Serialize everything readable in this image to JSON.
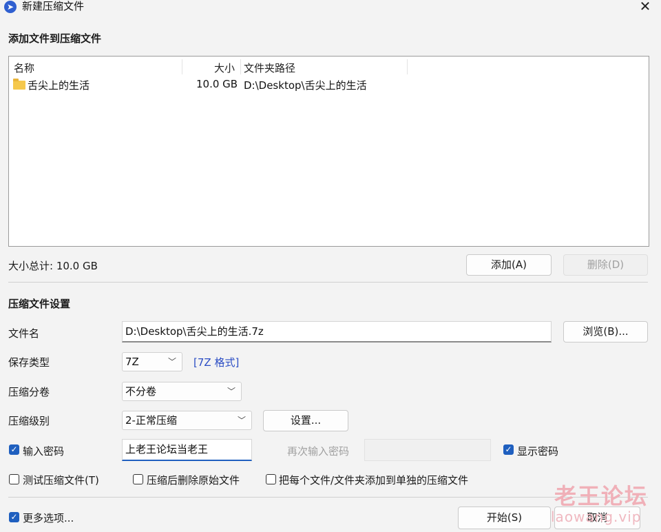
{
  "window": {
    "title": "新建压缩文件"
  },
  "add_section": {
    "title": "添加文件到压缩文件",
    "columns": {
      "name": "名称",
      "size": "大小",
      "path": "文件夹路径"
    },
    "rows": [
      {
        "name": "舌尖上的生活",
        "size": "10.0 GB",
        "path": "D:\\Desktop\\舌尖上的生活"
      }
    ],
    "total": "大小总计: 10.0 GB",
    "add_button": "添加(A)",
    "delete_button": "删除(D)"
  },
  "settings": {
    "title": "压缩文件设置",
    "filename_label": "文件名",
    "filename_value": "D:\\Desktop\\舌尖上的生活.7z",
    "browse_button": "浏览(B)...",
    "save_type_label": "保存类型",
    "save_type_value": "7Z",
    "format_link": "[7Z 格式]",
    "volume_label": "压缩分卷",
    "volume_value": "不分卷",
    "level_label": "压缩级别",
    "level_value": "2-正常压缩",
    "level_settings_button": "设置...",
    "password_checkbox": "输入密码",
    "password_value": "上老王论坛当老王",
    "password_repeat_placeholder": "再次输入密码",
    "show_password": "显示密码",
    "test_archive": "测试压缩文件(T)",
    "delete_after": "压缩后删除原始文件",
    "separate_archives": "把每个文件/文件夹添加到单独的压缩文件"
  },
  "footer": {
    "more_options": "更多选项...",
    "start_button": "开始(S)",
    "cancel_button": "取消"
  },
  "watermark": {
    "cn": "老王论坛",
    "en": "laowang.vip"
  },
  "icons": {
    "app": "app-logo-icon",
    "close": "close-icon",
    "folder": "folder-icon",
    "chevron": "chevron-down-icon",
    "check": "checkmark-icon"
  },
  "colors": {
    "accent": "#1f5fbf",
    "link": "#2a4cc4",
    "background": "#f3f3f3"
  }
}
